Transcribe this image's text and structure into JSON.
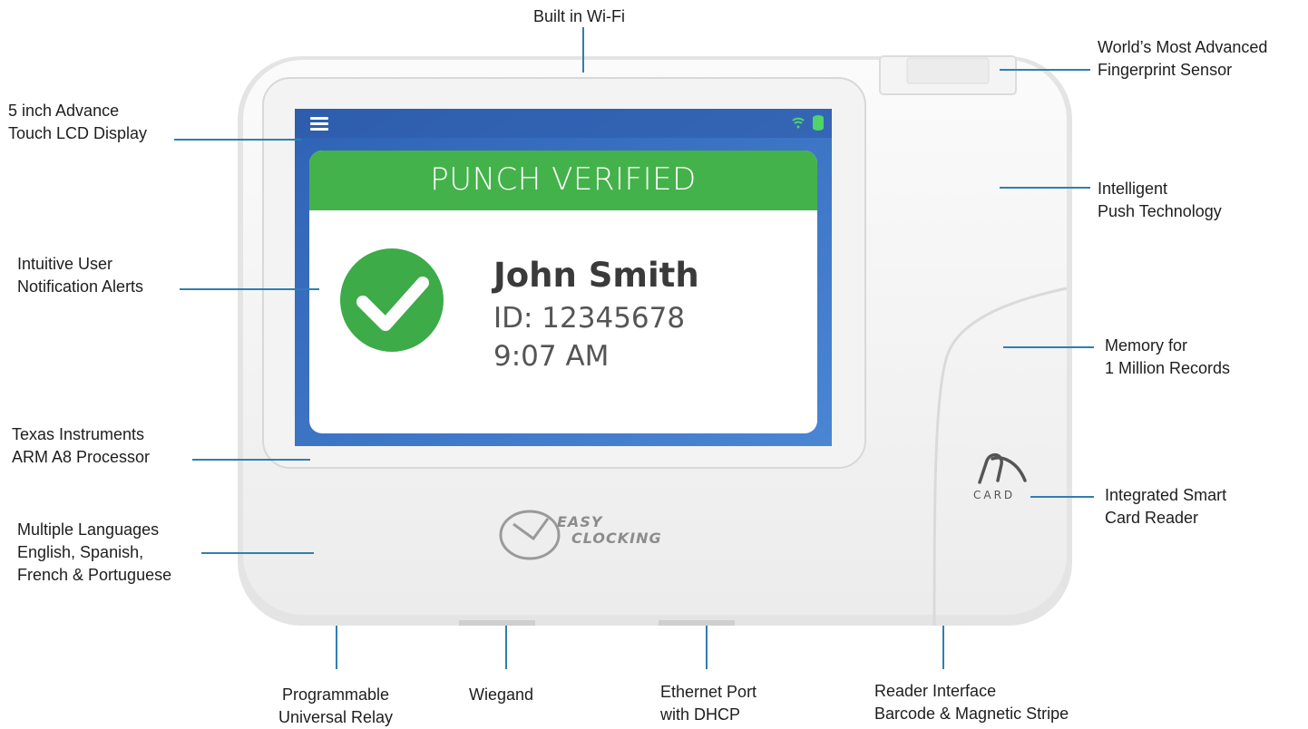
{
  "callouts": {
    "wifi": "Built in Wi-Fi",
    "fingerprint": [
      "World’s Most Advanced",
      "Fingerprint Sensor"
    ],
    "display": [
      "5 inch Advance",
      "Touch LCD Display"
    ],
    "push": [
      "Intelligent",
      "Push Technology"
    ],
    "alerts": [
      "Intuitive User",
      "Notification Alerts"
    ],
    "memory": [
      "Memory for",
      "1 Million Records"
    ],
    "processor": [
      "Texas Instruments",
      "ARM A8 Processor"
    ],
    "smartcard": [
      "Integrated Smart",
      "Card Reader"
    ],
    "languages": [
      "Multiple Languages",
      "English, Spanish,",
      "French & Portuguese"
    ],
    "relay": [
      "Programmable",
      "Universal Relay"
    ],
    "wiegand": "Wiegand",
    "ethernet": [
      "Ethernet Port",
      "with DHCP"
    ],
    "reader": [
      "Reader Interface",
      "Barcode & Magnetic Stripe"
    ]
  },
  "screen": {
    "banner": "PUNCH VERIFIED",
    "name": "John Smith",
    "id": "ID: 12345678",
    "time": "9:07 AM",
    "menu_icon": "hamburger-menu-icon",
    "status_icons": [
      "wifi-icon",
      "database-icon"
    ]
  },
  "device": {
    "logo_line1": "EASY",
    "logo_line2": "CLOCKING",
    "card_label": "CARD"
  },
  "colors": {
    "banner_green": "#44b24a",
    "screen_blue": "#3a72c4",
    "callout_line": "#2f7fb0",
    "check_green": "#3cab48"
  }
}
